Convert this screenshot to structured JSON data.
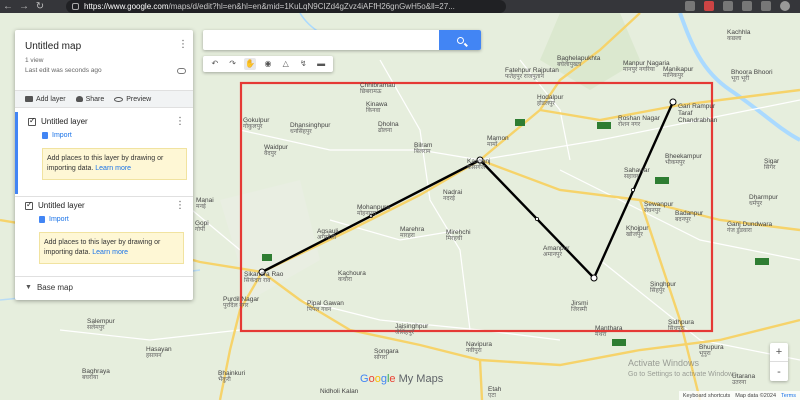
{
  "browser": {
    "url_host": "https://www.google.com",
    "url_path": "/maps/d/edit?hl=en&hl=en&mid=1KuLqN9CIZd4gZvz4iAFfH26gnGwH5o&ll=27..."
  },
  "panel": {
    "map_title": "Untitled map",
    "views": "1 view",
    "last_edit": "Last edit was seconds ago",
    "actions": {
      "add_layer": "Add layer",
      "share": "Share",
      "preview": "Preview"
    },
    "layers": [
      {
        "name": "Untitled layer",
        "import": "Import",
        "hint": "Add places to this layer by drawing or importing data.",
        "learn_more": "Learn more"
      },
      {
        "name": "Untitled layer",
        "import": "Import",
        "hint": "Add places to this layer by drawing or importing data.",
        "learn_more": "Learn more"
      }
    ],
    "base_map": "Base map"
  },
  "search": {
    "placeholder": "",
    "value": ""
  },
  "toolbar": {
    "icons": [
      "undo-icon",
      "redo-icon",
      "hand-icon",
      "marker-icon",
      "shape-icon",
      "route-icon",
      "ruler-icon"
    ]
  },
  "zoom": {
    "plus": "+",
    "minus": "-"
  },
  "branding": {
    "g1": "G",
    "g2": "o",
    "g3": "o",
    "g4": "g",
    "g5": "l",
    "g6": "e",
    "suffix": " My Maps"
  },
  "attribution": {
    "shortcuts": "Keyboard shortcuts",
    "data": "Map data ©2024",
    "terms": "Terms"
  },
  "watermark": {
    "line1": "Activate Windows",
    "line2": "Go to Settings to activate Windows."
  },
  "places": [
    {
      "en": "Chhibramau",
      "hi": "छिबरामऊ"
    },
    {
      "en": "Kinawa",
      "hi": "किनवा"
    },
    {
      "en": "Dholna",
      "hi": "ढोलना"
    },
    {
      "en": "Gokulpur",
      "hi": "गोकुलपुर"
    },
    {
      "en": "Dhansinghpur",
      "hi": "धनसिंहपुर"
    },
    {
      "en": "Waidpur",
      "hi": "वैदपुर"
    },
    {
      "en": "Bilram",
      "hi": "बिलराम"
    },
    {
      "en": "Mamon",
      "hi": "मामों"
    },
    {
      "en": "Kasganj",
      "hi": "कासगंज"
    },
    {
      "en": "Nadrai",
      "hi": "नदरई"
    },
    {
      "en": "Mohanpura",
      "hi": "मोहनपुरा"
    },
    {
      "en": "Agsauli",
      "hi": "अगसौली"
    },
    {
      "en": "Marehra",
      "hi": "मारहरा"
    },
    {
      "en": "Mirehchi",
      "hi": "मिरहची"
    },
    {
      "en": "Sikandra Rao",
      "hi": "सिकंदरा राव"
    },
    {
      "en": "Kachoura",
      "hi": "कचौरा"
    },
    {
      "en": "Pipal Gawan",
      "hi": "पिपल गवन"
    },
    {
      "en": "Jaisinghpur",
      "hi": "जैसिंहपुर"
    },
    {
      "en": "Purdil Nagar",
      "hi": "पुरदिल नगर"
    },
    {
      "en": "Hodalpur",
      "hi": "होडलपुर"
    },
    {
      "en": "Roshan Nagar",
      "hi": "रोशन नगर"
    },
    {
      "en": "Ganj Dundwara",
      "hi": "गंज डुंडवारा"
    },
    {
      "en": "Sahawar",
      "hi": "सहावर"
    },
    {
      "en": "Bheekampur",
      "hi": "भीकमपुर"
    },
    {
      "en": "Sewanpur",
      "hi": "सेवनपुर"
    },
    {
      "en": "Badanpur",
      "hi": "बदनपुर"
    },
    {
      "en": "Khojpur",
      "hi": "खोजपुर"
    },
    {
      "en": "Amanpur",
      "hi": "अमानपुर"
    },
    {
      "en": "Singhpur",
      "hi": "सिंहपुर"
    },
    {
      "en": "Jirsmi",
      "hi": "जिरस्मी"
    },
    {
      "en": "Sidhpura",
      "hi": "सिधपुरा"
    },
    {
      "en": "Manthara",
      "hi": "मंथरा"
    },
    {
      "en": "Navipura",
      "hi": "नवीपुरा"
    },
    {
      "en": "Songara",
      "hi": "सोंगरा"
    },
    {
      "en": "Etah",
      "hi": "एटा"
    },
    {
      "en": "Gari Rampur Taraf Chandrabhan",
      "hi": "गढ़ी रामपुर"
    },
    {
      "en": "Manikapur",
      "hi": "मानिकपुर"
    },
    {
      "en": "Kachhla",
      "hi": "कछला"
    },
    {
      "en": "Manpur Nagaria",
      "hi": "मानपुर नगरिया"
    },
    {
      "en": "Baghelapukhta",
      "hi": "बघेलापुख्ता"
    },
    {
      "en": "Fatehpur Rajputan",
      "hi": "फतेहपुर राजपूतान"
    },
    {
      "en": "Bhoora Bhoori",
      "hi": "भूरा भूरी"
    },
    {
      "en": "Dharmpur",
      "hi": "धर्मपुर"
    },
    {
      "en": "Bhupura",
      "hi": "भूपुरा"
    },
    {
      "en": "Salempur",
      "hi": "सलेमपुर"
    },
    {
      "en": "Hasayan",
      "hi": "हसायन"
    },
    {
      "en": "Baghraya",
      "hi": "बघराया"
    },
    {
      "en": "Bhainkuri",
      "hi": "भैंकुरी"
    },
    {
      "en": "Nidholi Kalan",
      "hi": "निधौली कलां"
    },
    {
      "en": "Utarana",
      "hi": "उतरना"
    },
    {
      "en": "Manai",
      "hi": "मनई"
    },
    {
      "en": "Gopi",
      "hi": "गोपी"
    },
    {
      "en": "Sigar",
      "hi": "सिगर"
    }
  ],
  "colors": {
    "route": "#000000",
    "frame": "#e53935",
    "accent": "#4285f4",
    "water": "#aadaff",
    "road_yellow": "#f6d36a",
    "road_white": "#ffffff"
  }
}
